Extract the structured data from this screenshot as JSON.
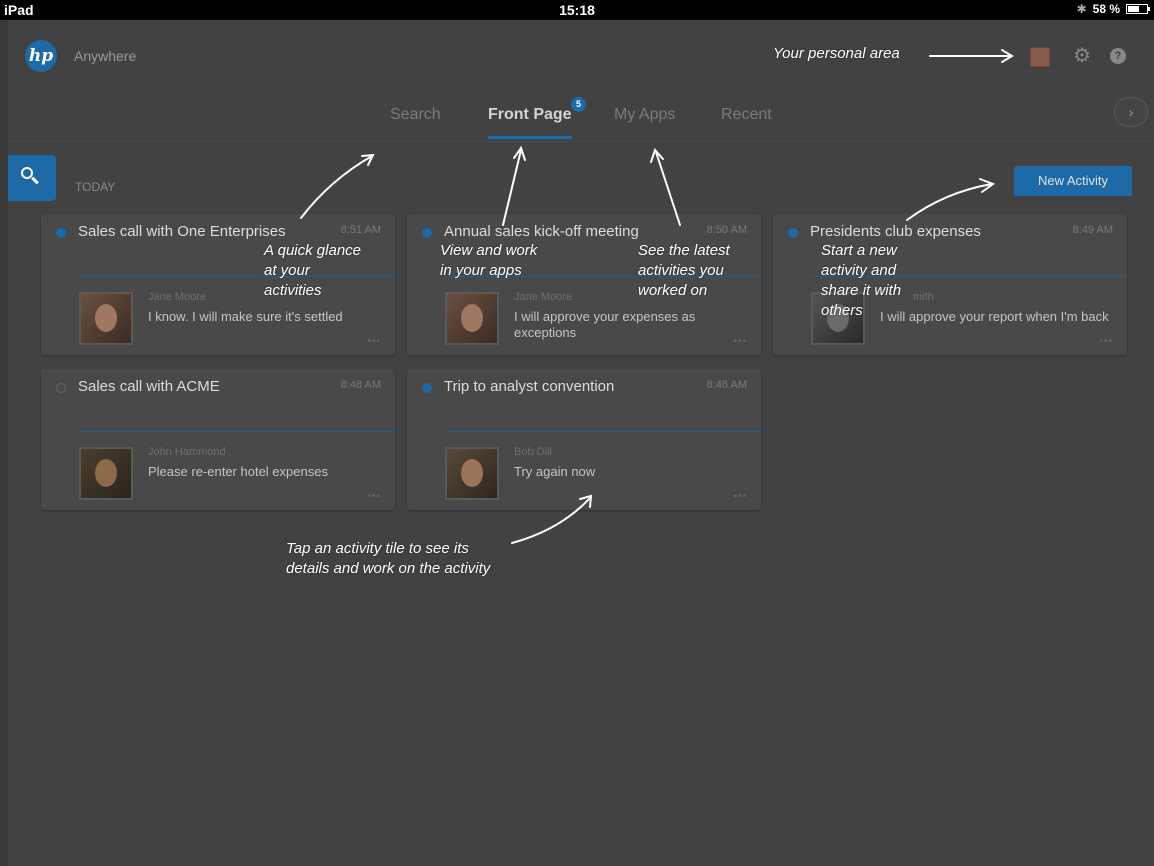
{
  "status_bar": {
    "device": "iPad",
    "time": "15:18",
    "bluetooth": "✱",
    "battery": "58 %"
  },
  "header": {
    "logo_text": "hp",
    "app_name": "Anywhere",
    "settings_icon": "gear-icon",
    "help_icon": "help-icon",
    "help_symbol": "?",
    "gear_symbol": "⚙"
  },
  "tabs": [
    {
      "label": "Search",
      "active": false
    },
    {
      "label": "Front Page",
      "active": true,
      "badge": "5"
    },
    {
      "label": "My Apps",
      "active": false
    },
    {
      "label": "Recent",
      "active": false
    }
  ],
  "next_button": "›",
  "section": {
    "label": "TODAY"
  },
  "new_activity_label": "New Activity",
  "activities": [
    {
      "title": "Sales call with One Enterprises",
      "time": "8:51 AM",
      "unread": true,
      "person": "Jane Moore",
      "message": "I know. I will make sure it's settled"
    },
    {
      "title": "Annual sales kick-off meeting",
      "time": "8:50 AM",
      "unread": true,
      "person": "Jane Moore",
      "message": "I will approve your expenses as exceptions"
    },
    {
      "title": "Presidents club expenses",
      "time": "8:49 AM",
      "unread": true,
      "person": "mith",
      "message": "I will approve your report when I'm back"
    },
    {
      "title": "Sales call with ACME",
      "time": "8:48 AM",
      "unread": false,
      "person": "John Hammond",
      "message": "Please re-enter hotel expenses"
    },
    {
      "title": "Trip to analyst convention",
      "time": "8:46 AM",
      "unread": true,
      "person": "Bob Dill",
      "message": "Try again now"
    }
  ],
  "more_glyph": "•••",
  "annotations": {
    "personal_area": "Your personal area",
    "quick_glance": [
      "A quick glance",
      "at your",
      "activities"
    ],
    "apps": [
      "View and work",
      "in your apps"
    ],
    "latest": [
      "See the latest",
      "activities you",
      "worked on"
    ],
    "new_activity": [
      "Start a new",
      "activity and",
      "share it with",
      "others"
    ],
    "tap_tile": [
      "Tap an activity tile to see its",
      "details and work on the activity"
    ]
  }
}
